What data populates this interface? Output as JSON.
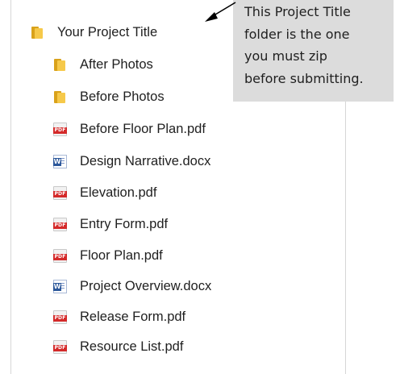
{
  "tree": {
    "root": {
      "label": "Your Project Title",
      "icon": "folder-icon"
    },
    "items": [
      {
        "label": "After Photos",
        "icon": "folder-icon"
      },
      {
        "label": "Before Photos",
        "icon": "folder-icon"
      },
      {
        "label": "Before Floor Plan.pdf",
        "icon": "pdf-icon",
        "badge": "PDF"
      },
      {
        "label": "Design Narrative.docx",
        "icon": "word-icon",
        "badge": "W"
      },
      {
        "label": "Elevation.pdf",
        "icon": "pdf-icon",
        "badge": "PDF"
      },
      {
        "label": "Entry Form.pdf",
        "icon": "pdf-icon",
        "badge": "PDF"
      },
      {
        "label": "Floor Plan.pdf",
        "icon": "pdf-icon",
        "badge": "PDF"
      },
      {
        "label": "Project Overview.docx",
        "icon": "word-icon",
        "badge": "W"
      },
      {
        "label": "Release Form.pdf",
        "icon": "pdf-icon",
        "badge": "PDF"
      },
      {
        "label": "Resource List.pdf",
        "icon": "pdf-icon",
        "badge": "PDF"
      }
    ]
  },
  "callout": {
    "lines": [
      "This Project Title",
      "folder is the one",
      "you must zip",
      "before submitting."
    ]
  },
  "colors": {
    "folder": "#f6c94a",
    "pdf": "#d42a2a",
    "word": "#2b579a",
    "callout_bg": "#dcdcdc"
  }
}
